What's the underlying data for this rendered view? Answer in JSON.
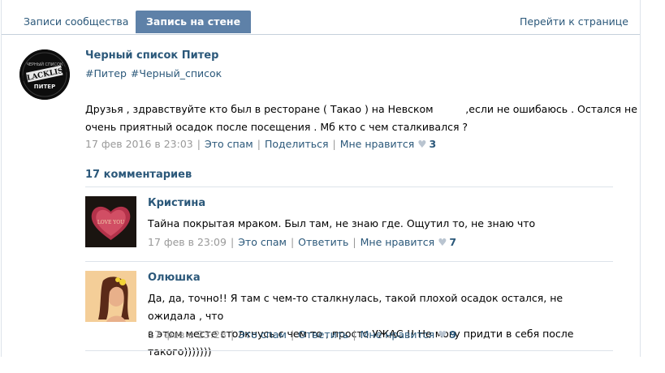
{
  "tabs": {
    "community_posts": "Записи сообщества",
    "wall_post": "Запись на стене",
    "goto_page": "Перейти к странице"
  },
  "post": {
    "author": "Черный список Питер",
    "avatar_text": [
      "ЧЕРНЫЙ СПИСОК",
      "BLACKLIST",
      "ПИТЕР"
    ],
    "hashtags": [
      "#Питер",
      "#Черный_список"
    ],
    "text_line1": "Друзья , здравствуйте кто был в ресторане ( Такао ) на Невском          ,если не ошибаюсь . Остался не",
    "text_line2": "очень приятный осадок после посещения . Мб кто с чем сталкивался ?",
    "date": "17 фев 2016 в 23:03",
    "spam": "Это спам",
    "share": "Поделиться",
    "like": "Мне нравится",
    "likes": "3"
  },
  "comments_header": "17 комментариев",
  "comments": [
    {
      "name": "Кристина",
      "avatar_text": "LOVE YOU",
      "text": "Тайна покрытая мраком. Был там, не знаю где. Ощутил то, не знаю что",
      "date": "17 фев в 23:09",
      "spam": "Это спам",
      "reply": "Ответить",
      "like": "Мне нравится",
      "likes": "7"
    },
    {
      "name": "Олюшка",
      "text_line1": "Да, да, точно!! Я там с чем-то сталкнулась, такой плохой осадок остался, не ожидала , что",
      "text_line2": "в этом месте столкнусь с чем то , просто УЖАС !! Не могу придти в себя после такого)))))))",
      "date": "17 фев в 23:28",
      "spam": "Это спам",
      "reply": "Ответить",
      "like": "Мне нравится",
      "likes": "9"
    }
  ],
  "colors": {
    "link": "#2b587a",
    "active_tab": "#5e81a8",
    "meta_grey": "#999999",
    "divider": "#dde3ea"
  }
}
